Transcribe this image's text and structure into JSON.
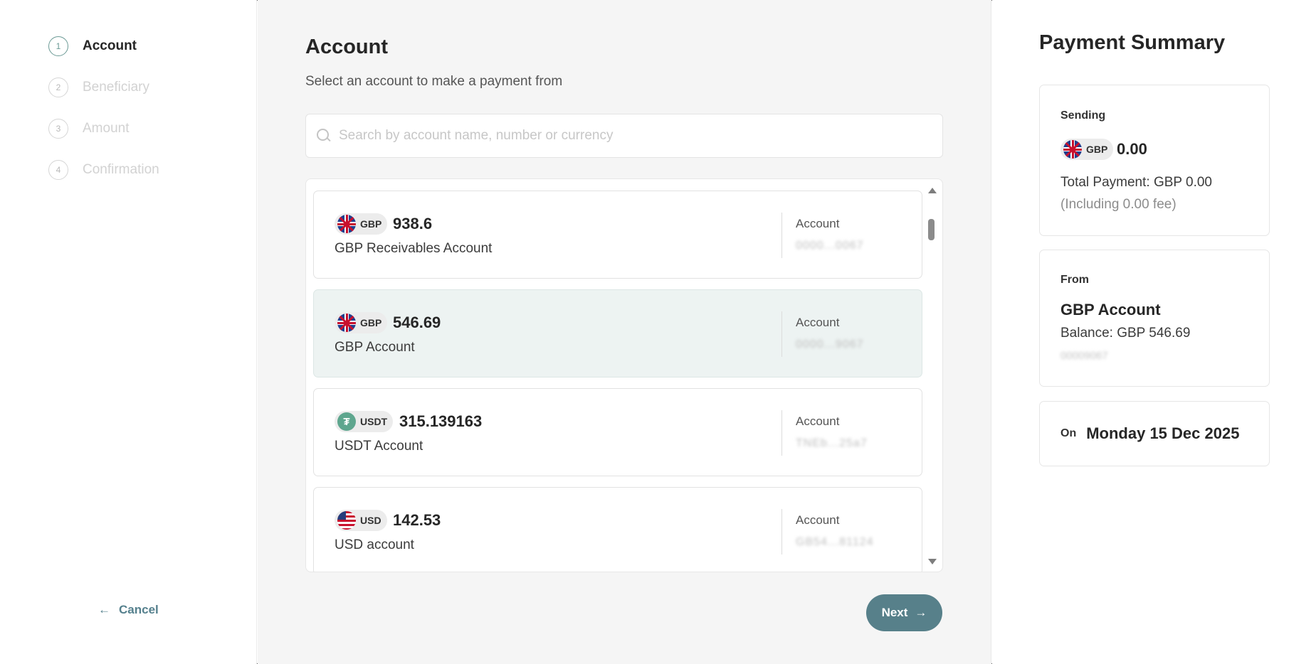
{
  "stepper": {
    "steps": [
      {
        "num": "1",
        "label": "Account"
      },
      {
        "num": "2",
        "label": "Beneficiary"
      },
      {
        "num": "3",
        "label": "Amount"
      },
      {
        "num": "4",
        "label": "Confirmation"
      }
    ],
    "cancel_label": "Cancel"
  },
  "main": {
    "title": "Account",
    "subtitle": "Select an account to make a payment from",
    "search_placeholder": "Search by account name, number or currency",
    "accounts": [
      {
        "currency": "GBP",
        "balance": "938.6",
        "name": "GBP Receivables Account",
        "account_label": "Account",
        "account_number": "0000...0067"
      },
      {
        "currency": "GBP",
        "balance": "546.69",
        "name": "GBP Account",
        "account_label": "Account",
        "account_number": "0000...9067"
      },
      {
        "currency": "USDT",
        "balance": "315.139163",
        "name": "USDT Account",
        "account_label": "Account",
        "account_number": "TNEb...25a7"
      },
      {
        "currency": "USD",
        "balance": "142.53",
        "name": "USD account",
        "account_label": "Account",
        "account_number": "GB54...81124"
      }
    ],
    "next_label": "Next"
  },
  "summary": {
    "title": "Payment Summary",
    "sending_label": "Sending",
    "sending_currency": "GBP",
    "sending_amount": "0.00",
    "total_payment": "Total Payment: GBP 0.00",
    "fee_note": "(Including 0.00 fee)",
    "from_label": "From",
    "from_account": "GBP Account",
    "from_balance": "Balance: GBP 546.69",
    "from_number": "00009067",
    "on_label": "On",
    "date": "Monday 15 Dec 2025"
  },
  "colors": {
    "accent": "#57808a",
    "selected_row": "#edf3f2",
    "active_step": "#6b9a95"
  }
}
